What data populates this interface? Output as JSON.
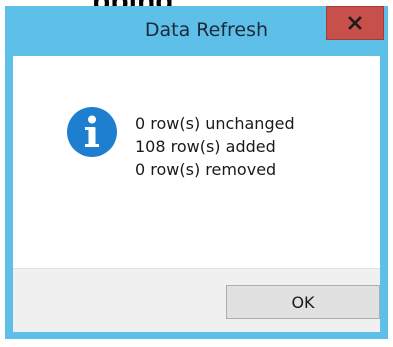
{
  "background": {
    "heading_fragment": "pping"
  },
  "dialog": {
    "title": "Data Refresh",
    "close_icon": "close-icon",
    "info_icon": "info-icon",
    "messages": [
      "0 row(s) unchanged",
      "108 row(s) added",
      "0 row(s) removed"
    ],
    "ok_label": "OK"
  },
  "colors": {
    "frame": "#5ec0e8",
    "close_button": "#c7504b",
    "info_icon": "#1e7fd1",
    "button_bar": "#f0f0f0",
    "ok_button": "#e1e1e1"
  }
}
